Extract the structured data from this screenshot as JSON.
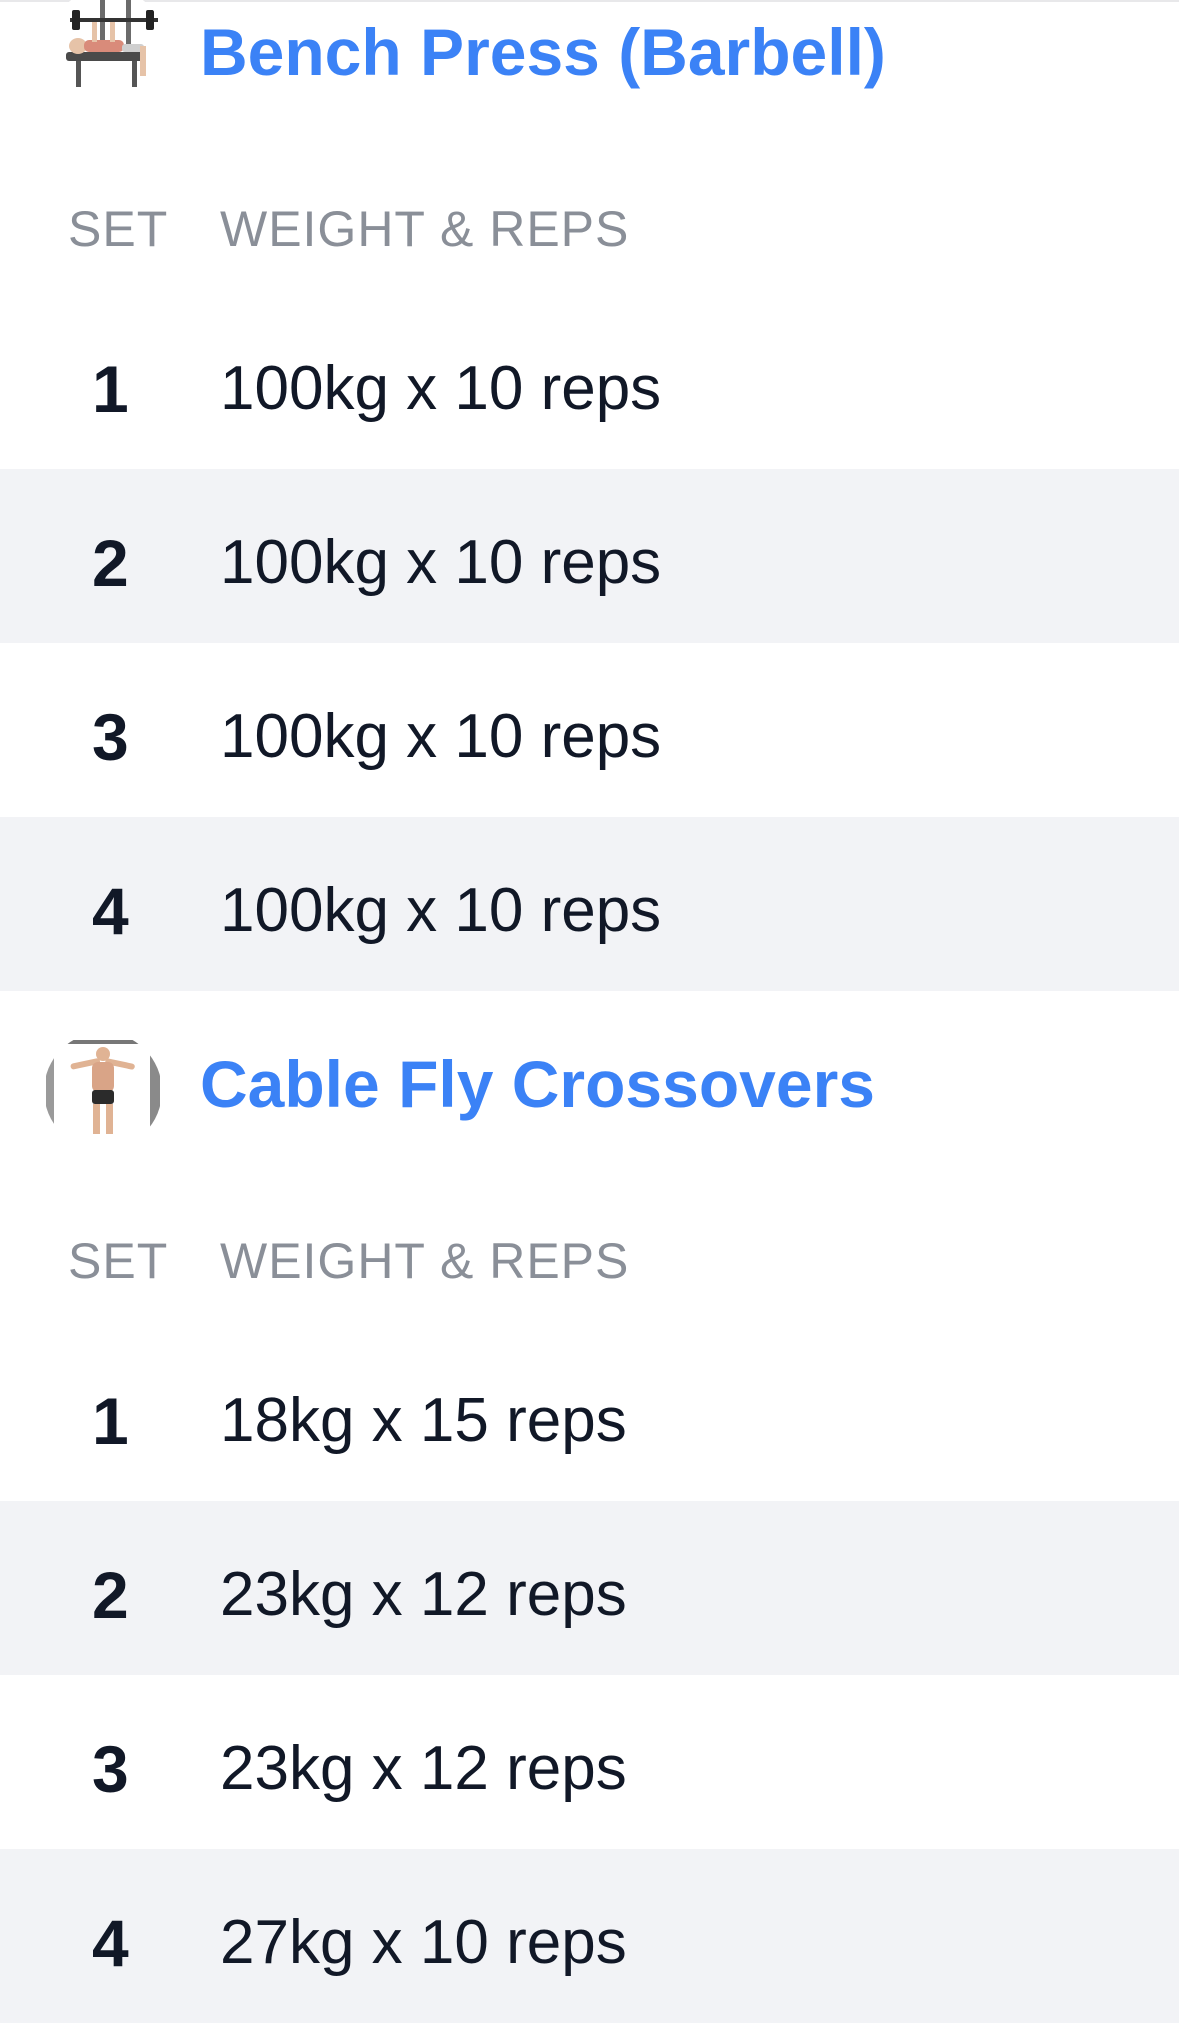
{
  "exercises": [
    {
      "title": "Bench Press (Barbell)",
      "thumbnail_icon": "bench-press-illustration",
      "headers": {
        "set": "SET",
        "weight_reps": "WEIGHT & REPS"
      },
      "sets": [
        {
          "set": "1",
          "value": "100kg x 10 reps"
        },
        {
          "set": "2",
          "value": "100kg x 10 reps"
        },
        {
          "set": "3",
          "value": "100kg x 10 reps"
        },
        {
          "set": "4",
          "value": "100kg x 10 reps"
        }
      ]
    },
    {
      "title": "Cable Fly Crossovers",
      "thumbnail_icon": "cable-fly-illustration",
      "headers": {
        "set": "SET",
        "weight_reps": "WEIGHT & REPS"
      },
      "sets": [
        {
          "set": "1",
          "value": "18kg x 15 reps"
        },
        {
          "set": "2",
          "value": "23kg x 12 reps"
        },
        {
          "set": "3",
          "value": "23kg x 12 reps"
        },
        {
          "set": "4",
          "value": "27kg x 10 reps"
        }
      ]
    }
  ],
  "colors": {
    "title": "#3b82f6",
    "header_text": "#8a8f98",
    "body_text": "#111827",
    "alt_row": "#f2f3f6"
  }
}
